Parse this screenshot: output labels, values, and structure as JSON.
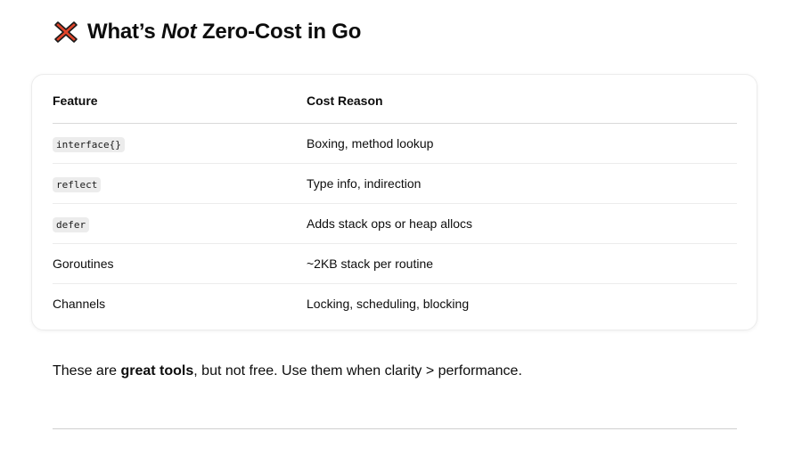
{
  "heading": {
    "icon": "cross-mark-icon",
    "prefix": "What’s ",
    "emphasis": "Not",
    "suffix": " Zero-Cost in Go"
  },
  "table": {
    "headers": [
      "Feature",
      "Cost Reason"
    ],
    "rows": [
      {
        "feature": "interface{}",
        "code": true,
        "reason": "Boxing, method lookup"
      },
      {
        "feature": "reflect",
        "code": true,
        "reason": "Type info, indirection"
      },
      {
        "feature": "defer",
        "code": true,
        "reason": "Adds stack ops or heap allocs"
      },
      {
        "feature": "Goroutines",
        "code": false,
        "reason": "~2KB stack per routine"
      },
      {
        "feature": "Channels",
        "code": false,
        "reason": "Locking, scheduling, blocking"
      }
    ]
  },
  "paragraph": {
    "before": "These are ",
    "bold": "great tools",
    "after": ", but not free. Use them when clarity > performance."
  },
  "colors": {
    "cross_icon": "#e0452b",
    "cross_outline": "#1a1a1a"
  }
}
